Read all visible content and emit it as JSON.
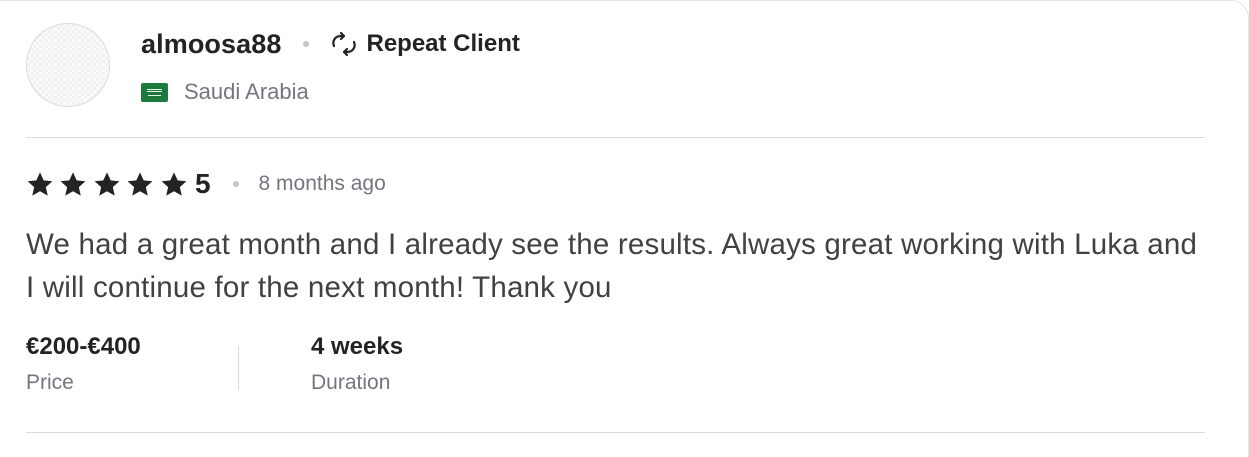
{
  "reviewer": {
    "username": "almoosa88",
    "badge_label": "Repeat Client",
    "badge_icon": "repeat-icon",
    "country": "Saudi Arabia",
    "country_flag": "saudi-arabia-flag"
  },
  "rating": {
    "stars": 5,
    "max_stars": 5,
    "value": "5",
    "time_ago": "8 months ago"
  },
  "review_text": "We had a great month and I already see the results. Always great working with Luka and I will continue for the next month! Thank you",
  "details": [
    {
      "value": "€200-€400",
      "label": "Price"
    },
    {
      "value": "4 weeks",
      "label": "Duration"
    }
  ],
  "colors": {
    "text_primary": "#222325",
    "text_secondary": "#74767e",
    "divider": "#dadbdd",
    "flag_green": "#1c7a3c"
  }
}
